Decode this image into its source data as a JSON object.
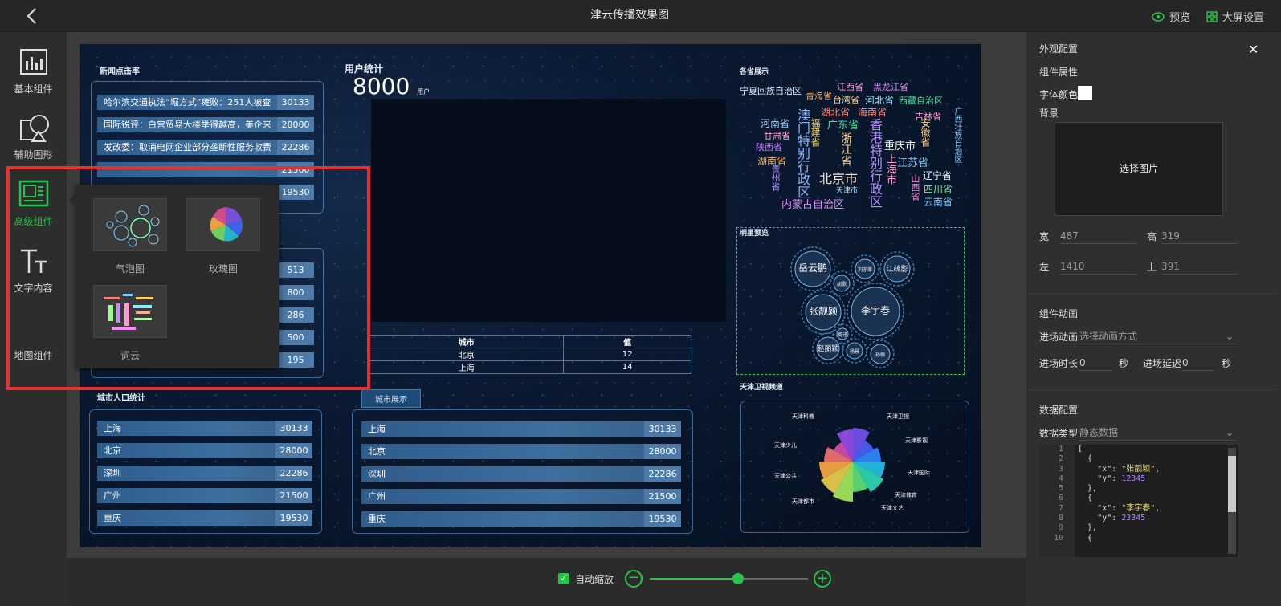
{
  "header": {
    "title": "津云传播效果图",
    "preview": "预览",
    "screen_settings": "大屏设置"
  },
  "toolbar": {
    "items": [
      {
        "label": "基本组件"
      },
      {
        "label": "辅助图形"
      },
      {
        "label": "高级组件"
      },
      {
        "label": "文字内容"
      },
      {
        "label": "地图组件"
      }
    ]
  },
  "popup": {
    "items": [
      {
        "label": "气泡图"
      },
      {
        "label": "玫瑰图"
      },
      {
        "label": "词云"
      }
    ]
  },
  "screen": {
    "news": {
      "title": "新闻点击率",
      "rows": [
        {
          "text": "哈尔滨交通执法“堀方式”瘫败：251人被查...",
          "value": "30133"
        },
        {
          "text": "国际锐评：白宫贸易大棒举得越高，美企来...",
          "value": "28000"
        },
        {
          "text": "发改委：取消电网企业部分垄断性服务收费...",
          "value": "22286"
        },
        {
          "text": "",
          "value": "21500"
        },
        {
          "text": "",
          "value": "19530"
        }
      ]
    },
    "news2": {
      "rows": [
        {
          "value": "513"
        },
        {
          "value": "800"
        },
        {
          "value": "286"
        },
        {
          "value": "500"
        },
        {
          "value": "195"
        }
      ]
    },
    "users": {
      "title": "用户统计",
      "value": "8000",
      "unit": "用户"
    },
    "city_table": {
      "headers": [
        "城市",
        "值"
      ],
      "rows": [
        [
          "北京",
          "12"
        ],
        [
          "上海",
          "14"
        ]
      ]
    },
    "city_pop": {
      "title": "城市人口统计",
      "rows": [
        {
          "city": "上海",
          "value": "30133"
        },
        {
          "city": "北京",
          "value": "28000"
        },
        {
          "city": "深圳",
          "value": "22286"
        },
        {
          "city": "广州",
          "value": "21500"
        },
        {
          "city": "重庆",
          "value": "19530"
        }
      ]
    },
    "city_show": {
      "title": "城市展示",
      "rows": [
        {
          "city": "上海",
          "value": "30133"
        },
        {
          "city": "北京",
          "value": "28000"
        },
        {
          "city": "深圳",
          "value": "22286"
        },
        {
          "city": "广州",
          "value": "21500"
        },
        {
          "city": "重庆",
          "value": "19530"
        }
      ]
    },
    "provinces": {
      "title": "各省展示",
      "words": [
        "宁夏回族自治区",
        "江西省",
        "黑龙江省",
        "青海省",
        "台湾省",
        "河北省",
        "西藏自治区",
        "湖北省",
        "海南省",
        "吉林省",
        "广西壮族自治区",
        "河南省",
        "澳门特别行政区",
        "福建省",
        "广东省",
        "香港特别行政区",
        "安徽省",
        "甘肃省",
        "浙江省",
        "重庆市",
        "陕西省",
        "上海市",
        "江苏省",
        "湖南省",
        "北京市",
        "辽宁省",
        "贵州省",
        "天津市",
        "山西省",
        "四川省",
        "内蒙古自治区",
        "云南省"
      ]
    },
    "stars": {
      "title": "明星预览",
      "names": [
        "岳云鹏",
        "刘亦菲",
        "江疏影",
        "胡歌",
        "张靓颖",
        "李宇春",
        "孙俪",
        "赵丽颖",
        "杨幂",
        "周迅"
      ]
    },
    "tv": {
      "title": "天津卫视频道",
      "labels": [
        "天津卫视",
        "天津影视",
        "天津国际",
        "天津体育",
        "天津文艺",
        "天津都市",
        "天津公共",
        "天津少儿",
        "天津科教"
      ]
    }
  },
  "panel": {
    "appearance": "外观配置",
    "component_props": "组件属性",
    "font_color": "字体颜色",
    "background": "背景",
    "choose_image": "选择图片",
    "width_label": "宽",
    "width": "487",
    "height_label": "高",
    "height": "319",
    "left_label": "左",
    "left": "1410",
    "top_label": "上",
    "top": "391",
    "animation_title": "组件动画",
    "enter_anim": "进场动画",
    "enter_anim_placeholder": "选择动画方式",
    "enter_duration": "进场时长",
    "duration_val": "0",
    "sec": "秒",
    "enter_delay": "进场延迟",
    "delay_val": "0",
    "data_config": "数据配置",
    "data_type": "数据类型",
    "data_type_val": "静态数据",
    "line_numbers": [
      "1",
      "2",
      "3",
      "4",
      "5",
      "6",
      "7",
      "8",
      "9",
      "10"
    ]
  },
  "bottom": {
    "auto_scale": "自动缩放",
    "zoom_fraction": 0.56
  },
  "colors": {
    "accent": "#29c24a",
    "highlight": "#e8302f"
  }
}
